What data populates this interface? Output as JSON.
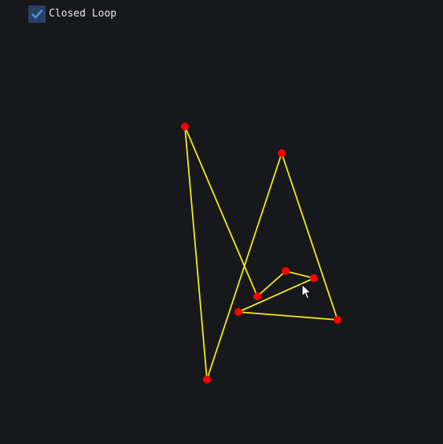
{
  "controls": {
    "closed_loop": {
      "label": "Closed Loop",
      "checked": true,
      "check_icon": "checkmark-icon"
    }
  },
  "colors": {
    "background": "#17181b",
    "line": "#f2ea1a",
    "point": "#ff0000",
    "checkbox_bg": "#2a3f63",
    "checkmark": "#4a90e0",
    "label": "#e8e8e8"
  },
  "icons": {
    "cursor": "mouse-pointer-icon"
  }
}
